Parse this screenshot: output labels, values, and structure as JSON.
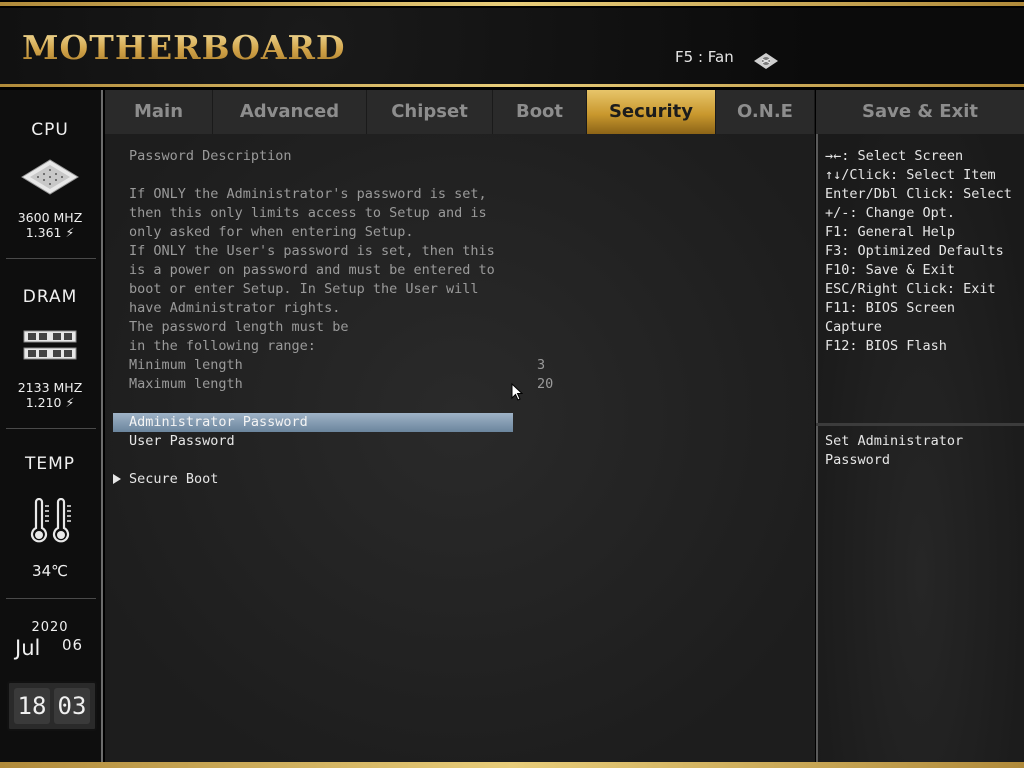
{
  "header": {
    "brand": "MOTHERBOARD",
    "fan_hint": "F5 : Fan"
  },
  "sidebar": {
    "cpu": {
      "title": "CPU",
      "freq": "3600 MHZ",
      "volt": "1.361 ⚡"
    },
    "dram": {
      "title": "DRAM",
      "freq": "2133 MHZ",
      "volt": "1.210 ⚡"
    },
    "temp": {
      "title": "TEMP",
      "value": "34℃"
    },
    "date": {
      "year": "2020",
      "month": "Jul",
      "day": "06"
    },
    "clock": {
      "hour": "18",
      "minute": "03"
    }
  },
  "tabs": [
    {
      "label": "Main"
    },
    {
      "label": "Advanced"
    },
    {
      "label": "Chipset"
    },
    {
      "label": "Boot"
    },
    {
      "label": "Security",
      "active": true
    },
    {
      "label": "O.N.E"
    }
  ],
  "save_tab": "Save & Exit",
  "content": {
    "heading": "Password Description",
    "description": [
      "If ONLY the Administrator's password is set,",
      "then this only limits access to Setup and is",
      "only asked for when entering Setup.",
      "If ONLY the User's password is set, then this",
      "is a power on password and must be entered to",
      "boot or enter Setup. In Setup the User will",
      "have Administrator rights.",
      "The password length must be",
      "in the following range:"
    ],
    "min_label": "Minimum length",
    "min_value": "3",
    "max_label": "Maximum length",
    "max_value": "20",
    "items": [
      {
        "label": "Administrator Password",
        "selected": true
      },
      {
        "label": "User Password"
      }
    ],
    "submenu": "Secure Boot"
  },
  "help": {
    "keys": [
      "→←: Select Screen",
      "↑↓/Click: Select Item",
      "Enter/Dbl Click: Select",
      "+/-: Change Opt.",
      "F1: General Help",
      "F3: Optimized Defaults",
      "F10: Save & Exit",
      "ESC/Right Click: Exit",
      "F11: BIOS Screen",
      "Capture",
      "F12: BIOS Flash"
    ],
    "item_help": [
      "Set Administrator",
      "Password"
    ]
  },
  "colors": {
    "gold": "#d8b25a",
    "selection": "#8aa0b6",
    "active_tab": "#c9982e"
  }
}
